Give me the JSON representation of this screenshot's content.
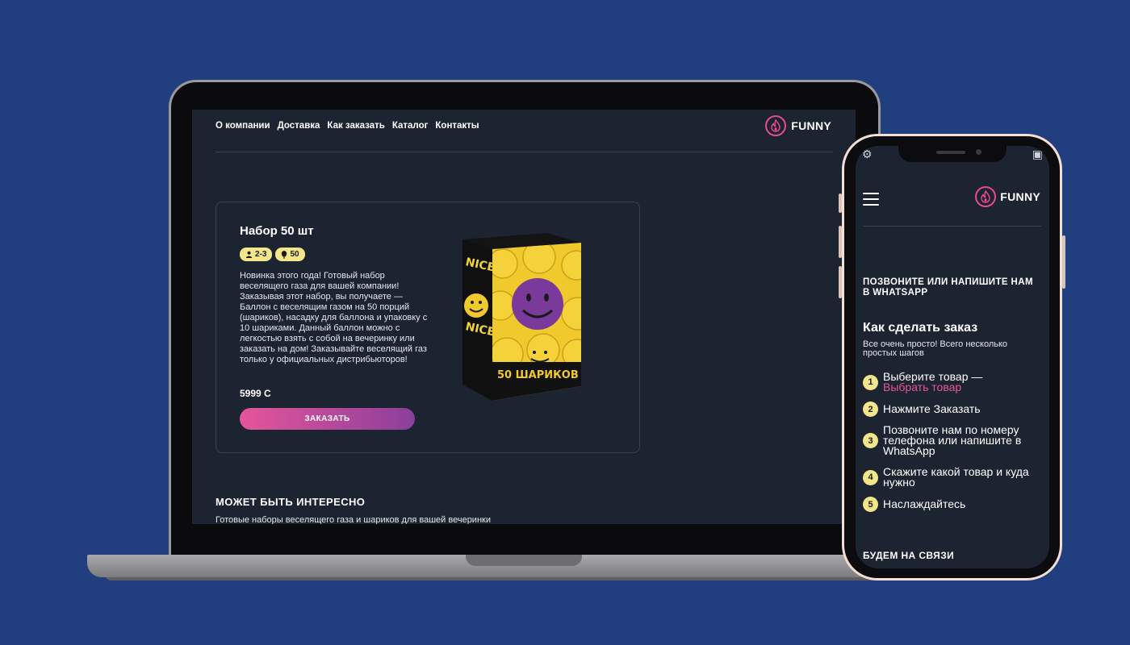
{
  "laptop": {
    "nav": [
      "О компании",
      "Доставка",
      "Как заказать",
      "Каталог",
      "Контакты"
    ],
    "logo_text": "FUNNY",
    "product": {
      "title": "Набор 50 шт",
      "badges": [
        {
          "icon": "person-icon",
          "label": "2-3"
        },
        {
          "icon": "balloon-icon",
          "label": "50"
        }
      ],
      "description": "Новинка этого года! Готовый набор веселящего газа для вашей компании! Заказывая этот набор, вы получаете — Баллон с веселящим газом на 50 порций (шариков), насадку для баллона и упаковку с 10 шариками. Данный баллон можно с легкостью взять с собой на вечеринку или заказать на дом! Заказывайте веселящий газ только у официальных дистрибьюторов!",
      "price": "5999 С",
      "order_label": "ЗАКАЗАТЬ",
      "box_side_text": "NICE GAZ",
      "box_front_text": "50 ШАРИКОВ"
    },
    "section_title": "МОЖЕТ БЫТЬ ИНТЕРЕСНО",
    "section_subtitle": "Готовые наборы веселящего газа и шариков для вашей вечеринки"
  },
  "phone": {
    "logo_text": "FUNNY",
    "call_heading": "ПОЗВОНИТЕ ИЛИ НАПИШИТЕ НАМ В WHATSAPP",
    "howto_title": "Как сделать заказ",
    "howto_subtitle": "Все очень просто! Всего несколько простых шагов",
    "steps": [
      {
        "num": "1",
        "text": "Выберите товар —",
        "link": "Выбрать товар"
      },
      {
        "num": "2",
        "text": "Нажмите Заказать"
      },
      {
        "num": "3",
        "text": "Позвоните нам по номеру телефона или напишите в WhatsApp"
      },
      {
        "num": "4",
        "text": "Скажите какой товар и куда нужно"
      },
      {
        "num": "5",
        "text": "Наслаждайтесь"
      }
    ],
    "contact_heading": "БУДЕМ НА СВЯЗИ"
  },
  "colors": {
    "background": "#213f7e",
    "screen": "#1c2331",
    "accent_pink": "#e6559a",
    "accent_purple": "#8a3f9b",
    "badge_yellow": "#f2e58a"
  }
}
